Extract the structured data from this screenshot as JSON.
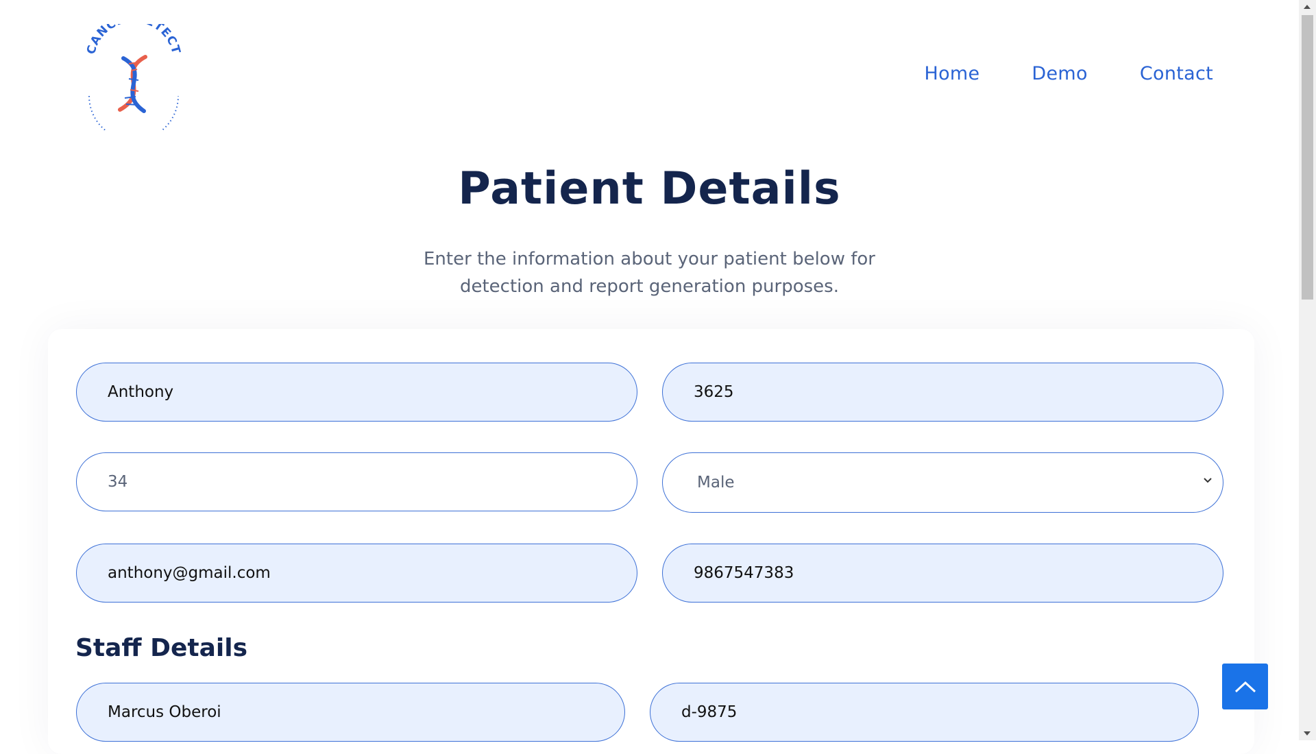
{
  "logo": {
    "text": "CANCERDETECT",
    "icon": "dna-helix-icon"
  },
  "nav": {
    "items": [
      "Home",
      "Demo",
      "Contact"
    ]
  },
  "page": {
    "title": "Patient Details",
    "subtitle_line1": "Enter the information about your patient below for",
    "subtitle_line2": "detection and report generation purposes."
  },
  "patient": {
    "name": "Anthony",
    "id": "3625",
    "age": "34",
    "gender": "Male",
    "email": "anthony@gmail.com",
    "phone": "9867547383"
  },
  "staff": {
    "heading": "Staff Details",
    "name": "Marcus Oberoi",
    "id": "d-9875"
  },
  "colors": {
    "accent": "#2a63d4",
    "title": "#14254d",
    "field_bg": "#e8f0fe",
    "button": "#1a73e8"
  },
  "icons": {
    "back_to_top": "chevron-up-icon",
    "select": "chevron-down-icon"
  }
}
